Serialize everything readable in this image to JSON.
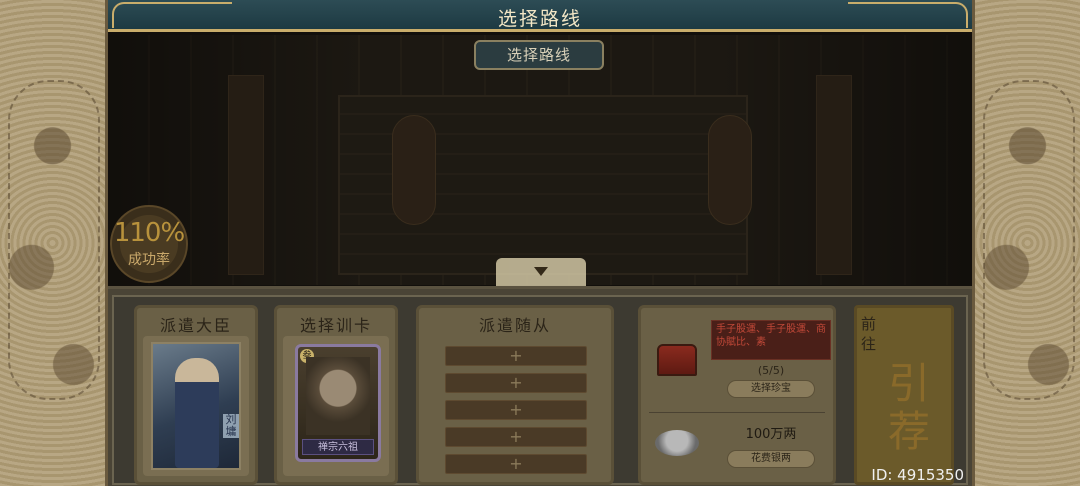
{
  "header": {
    "title": "选择路线"
  },
  "scene": {
    "subtitle": "选择路线"
  },
  "success_rate": {
    "percent": "110%",
    "label": "成功率"
  },
  "panels": {
    "minister": {
      "title": "派遣大臣",
      "name": "刘墉"
    },
    "training": {
      "title": "选择训卡",
      "card_name": "禅宗六祖",
      "badge": "叁"
    },
    "followers": {
      "title": "派遣随从",
      "slots": [
        "+",
        "+",
        "+",
        "+",
        "+"
      ]
    },
    "treasure": {
      "tags": "手子股運、手子股運、商协賦比、素",
      "count": "(5/5)",
      "select_button": "选择珍宝",
      "silver_amount": "100万两",
      "spend_button": "花费银两"
    },
    "go": {
      "label": "前往",
      "recommend": "引荐"
    }
  },
  "footer": {
    "id_text": "ID: 4915350"
  }
}
